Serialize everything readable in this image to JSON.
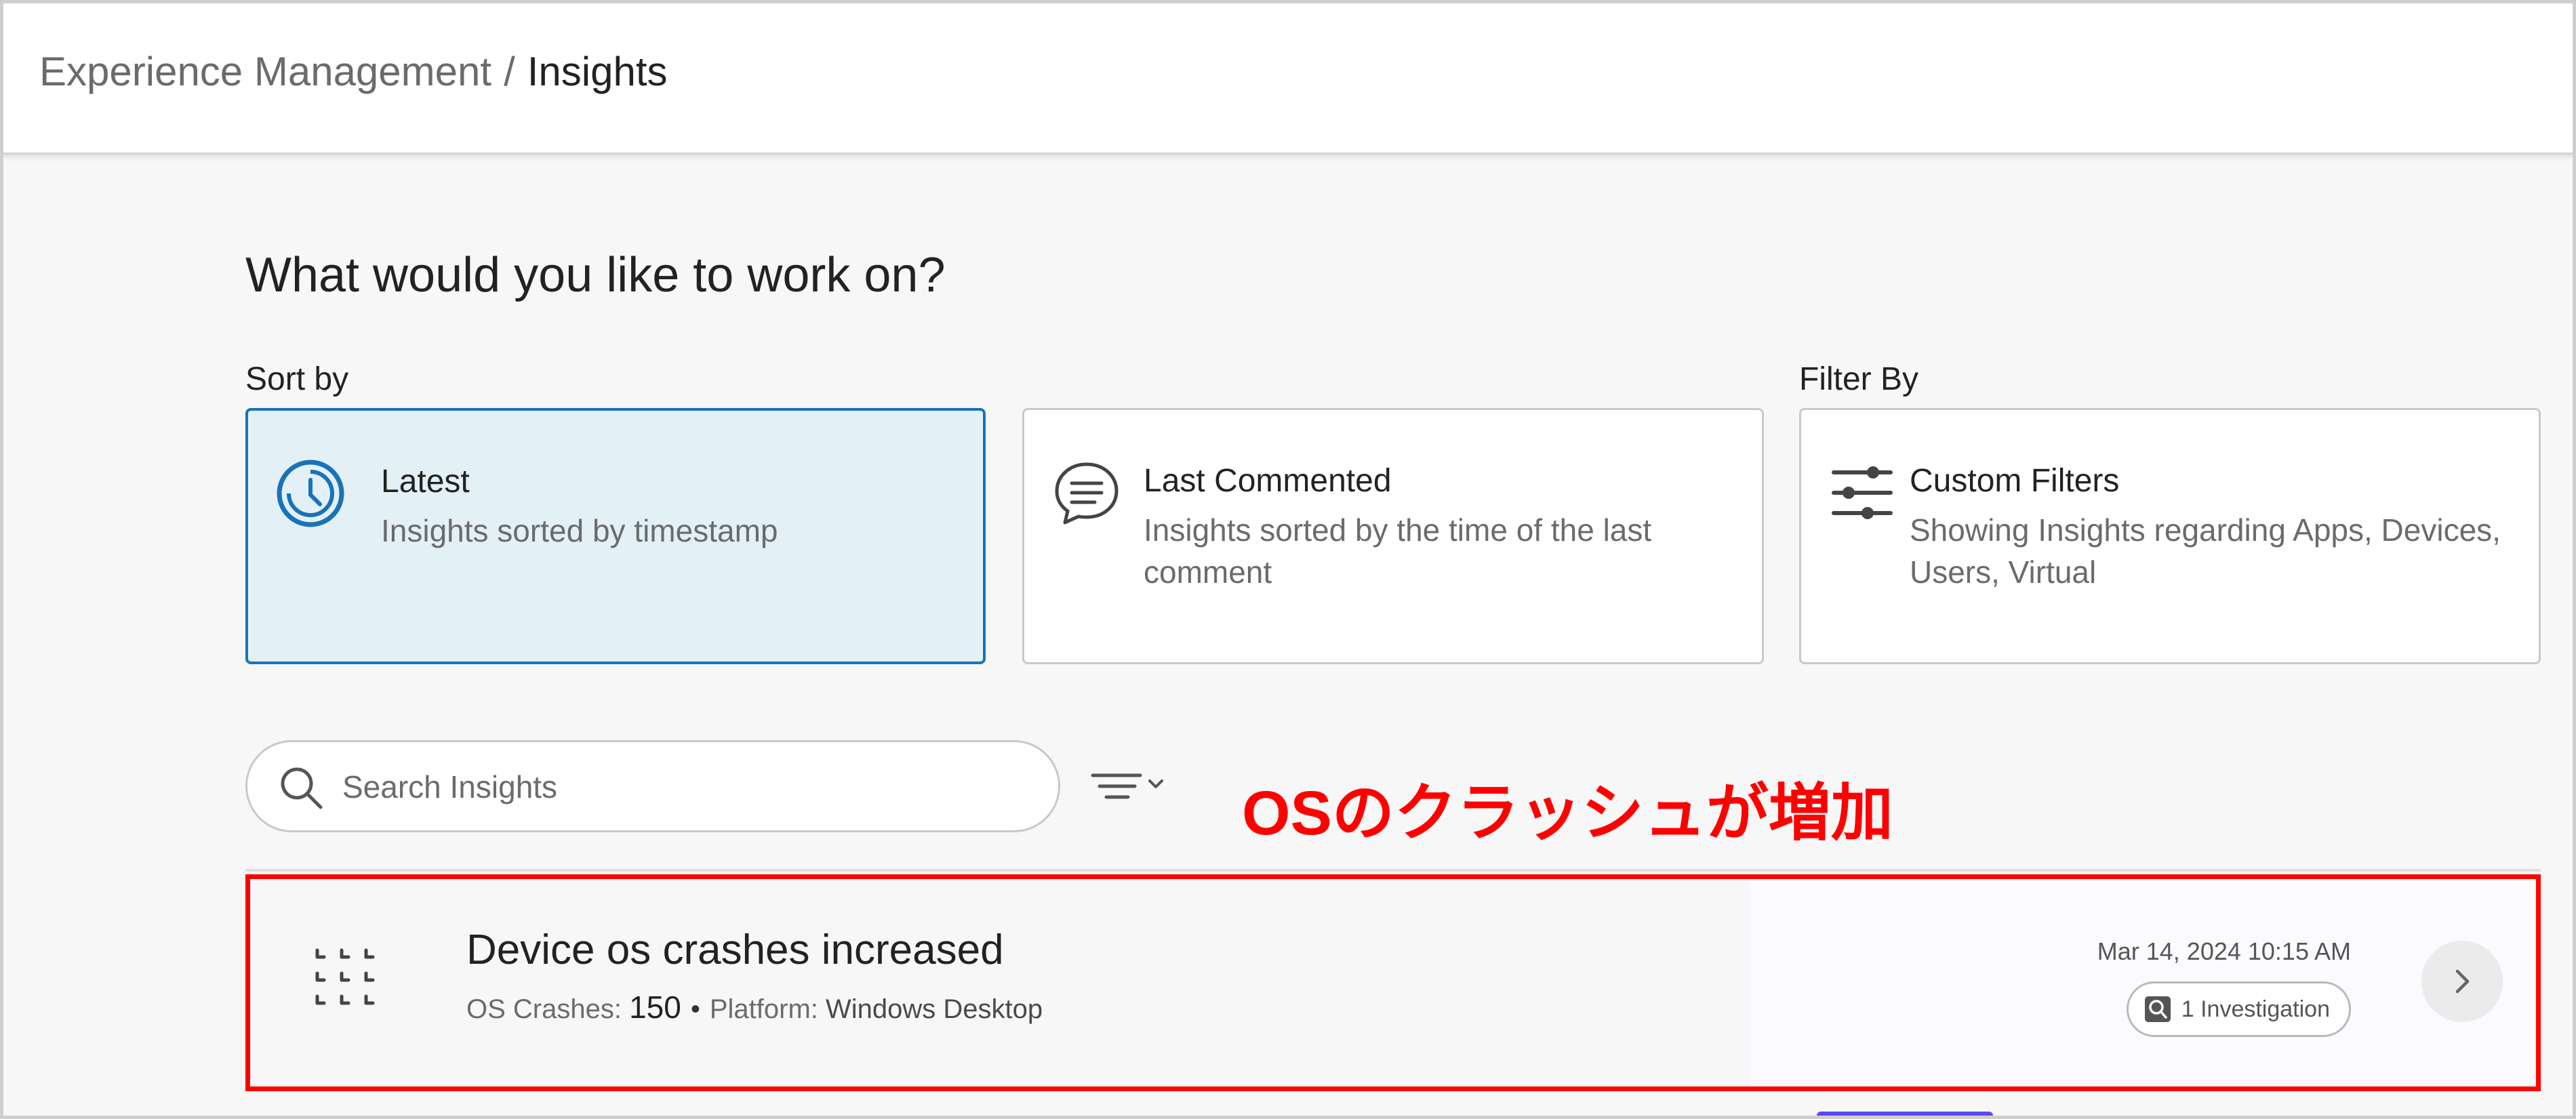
{
  "breadcrumb": {
    "parent": "Experience Management",
    "separator": "/",
    "current": "Insights"
  },
  "page": {
    "heading": "What would you like to work on?"
  },
  "sort_section": {
    "label": "Sort by",
    "options": [
      {
        "title": "Latest",
        "description": "Insights sorted by timestamp",
        "icon": "clock-icon",
        "selected": true
      },
      {
        "title": "Last Commented",
        "description": "Insights sorted by the time of the last comment",
        "icon": "comment-icon",
        "selected": false
      }
    ]
  },
  "filter_section": {
    "label": "Filter By",
    "option": {
      "title": "Custom Filters",
      "description": "Showing Insights regarding Apps, Devices, Users, Virtual",
      "icon": "sliders-icon"
    }
  },
  "search": {
    "placeholder": "Search Insights",
    "value": ""
  },
  "annotation": {
    "text": "OSのクラッシュが増加",
    "color": "#ff0000"
  },
  "insights": [
    {
      "title": "Device os crashes increased",
      "metric_label": "OS Crashes:",
      "metric_value": "150",
      "platform_label": "Platform:",
      "platform_value": "Windows Desktop",
      "timestamp": "Mar 14, 2024 10:15 AM",
      "investigation": "1 Investigation"
    }
  ],
  "colors": {
    "accent": "#1a73b8",
    "selected_card_bg": "#e3f1f6",
    "highlight": "#ff0000"
  }
}
